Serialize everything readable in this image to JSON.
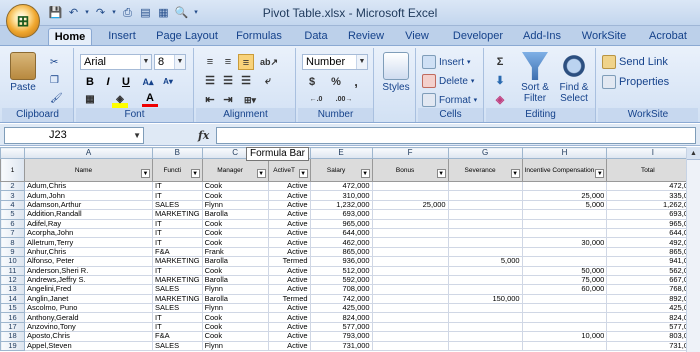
{
  "window": {
    "title": "Pivot Table.xlsx - Microsoft Excel"
  },
  "tabs": [
    "Home",
    "Insert",
    "Page Layout",
    "Formulas",
    "Data",
    "Review",
    "View",
    "Developer",
    "Add-Ins",
    "WorkSite",
    "Acrobat"
  ],
  "ribbon": {
    "clipboard": {
      "label": "Clipboard",
      "paste": "Paste"
    },
    "font": {
      "label": "Font",
      "name": "Arial",
      "size": "8",
      "bold": "B",
      "italic": "I",
      "underline": "U"
    },
    "alignment": {
      "label": "Alignment"
    },
    "number": {
      "label": "Number",
      "format": "Number",
      "currency": "$",
      "percent": "%",
      "comma": ","
    },
    "styles": {
      "label": "Styles"
    },
    "cells": {
      "label": "Cells",
      "insert": "Insert",
      "delete": "Delete",
      "format": "Format"
    },
    "editing": {
      "label": "Editing",
      "sort": "Sort &",
      "filter": "Filter",
      "find": "Find &",
      "select": "Select"
    },
    "worksite": {
      "label": "WorkSite",
      "send": "Send Link",
      "props": "Properties"
    }
  },
  "formula_bar": {
    "cell": "J23",
    "fx": "fx",
    "value": "",
    "tooltip": "Formula Bar"
  },
  "columns": [
    "",
    "A",
    "B",
    "C",
    "D",
    "E",
    "F",
    "G",
    "H",
    "I"
  ],
  "headers": [
    "Name",
    "Functi",
    "Manager",
    "ActiveT",
    "Salary",
    "Bonus",
    "Severance",
    "Incentive Compensation",
    "Total"
  ],
  "rows": [
    [
      "Adum,Chris",
      "IT",
      "Cook",
      "Active",
      "472,000",
      "",
      "",
      "",
      "472,000"
    ],
    [
      "Adum,John",
      "IT",
      "Cook",
      "Active",
      "310,000",
      "",
      "",
      "25,000",
      "335,000"
    ],
    [
      "Adamson,Arthur",
      "SALES",
      "Flynn",
      "Active",
      "1,232,000",
      "25,000",
      "",
      "5,000",
      "1,262,000"
    ],
    [
      "Addition,Randall",
      "MARKETING",
      "Barolla",
      "Active",
      "693,000",
      "",
      "",
      "",
      "693,000"
    ],
    [
      "Adifel,Ray",
      "IT",
      "Cook",
      "Active",
      "965,000",
      "",
      "",
      "",
      "965,000"
    ],
    [
      "Acorpha,John",
      "IT",
      "Cook",
      "Active",
      "644,000",
      "",
      "",
      "",
      "644,000"
    ],
    [
      "Alletrum,Terry",
      "IT",
      "Cook",
      "Active",
      "462,000",
      "",
      "",
      "30,000",
      "492,000"
    ],
    [
      "Anhur,Chris",
      "F&A",
      "Frank",
      "Active",
      "865,000",
      "",
      "",
      "",
      "865,000"
    ],
    [
      "Alfonso, Peter",
      "MARKETING",
      "Barolla",
      "Termed",
      "936,000",
      "",
      "5,000",
      "",
      "941,000"
    ],
    [
      "Anderson,Sheri R.",
      "IT",
      "Cook",
      "Active",
      "512,000",
      "",
      "",
      "50,000",
      "562,000"
    ],
    [
      "Andrews,Jeffry S.",
      "MARKETING",
      "Barolla",
      "Active",
      "592,000",
      "",
      "",
      "75,000",
      "667,000"
    ],
    [
      "Angelini,Fred",
      "SALES",
      "Flynn",
      "Active",
      "708,000",
      "",
      "",
      "60,000",
      "768,000"
    ],
    [
      "Anglin,Janet",
      "MARKETING",
      "Barolla",
      "Termed",
      "742,000",
      "",
      "150,000",
      "",
      "892,000"
    ],
    [
      "Ascolmo, Puno",
      "SALES",
      "Flynn",
      "Active",
      "425,000",
      "",
      "",
      "",
      "425,000"
    ],
    [
      "Anthony,Gerald",
      "IT",
      "Cook",
      "Active",
      "824,000",
      "",
      "",
      "",
      "824,000"
    ],
    [
      "Anzovino,Tony",
      "IT",
      "Cook",
      "Active",
      "577,000",
      "",
      "",
      "",
      "577,000"
    ],
    [
      "Aposto,Chris",
      "F&A",
      "Cook",
      "Active",
      "793,000",
      "",
      "",
      "10,000",
      "803,000"
    ],
    [
      "Appel,Steven",
      "SALES",
      "Flynn",
      "Active",
      "731,000",
      "",
      "",
      "",
      "731,000"
    ]
  ]
}
